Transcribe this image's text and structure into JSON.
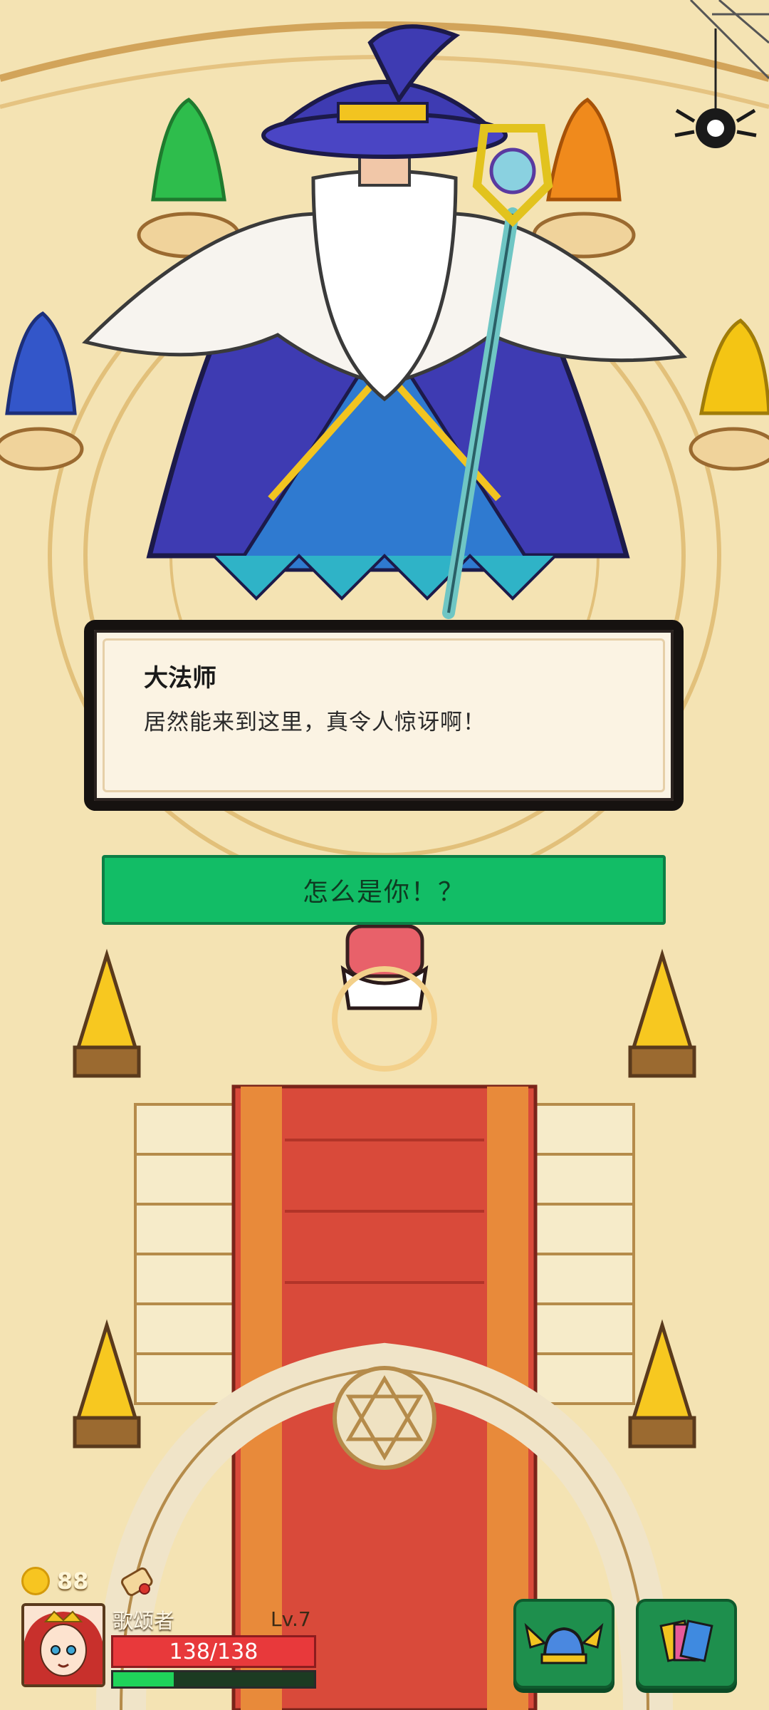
{
  "dialog": {
    "speaker": "大法师",
    "line": "居然能来到这里，真令人惊讶啊！"
  },
  "choice": {
    "label": "怎么是你！？"
  },
  "hud": {
    "coins": "88",
    "player_name": "歌颂者",
    "level": "Lv.7",
    "hp_text": "138/138",
    "xp_fraction": 0.3
  },
  "colors": {
    "choice_green": "#12bd66",
    "hp_red": "#e8393b",
    "xp_green": "#1fd35a",
    "carpet_red": "#d94a3a"
  },
  "icons": {
    "helmet": "winged-helmet-icon",
    "cards": "cards-icon",
    "scroll": "scroll-icon",
    "coin": "coin-icon",
    "spider": "spider-icon"
  }
}
